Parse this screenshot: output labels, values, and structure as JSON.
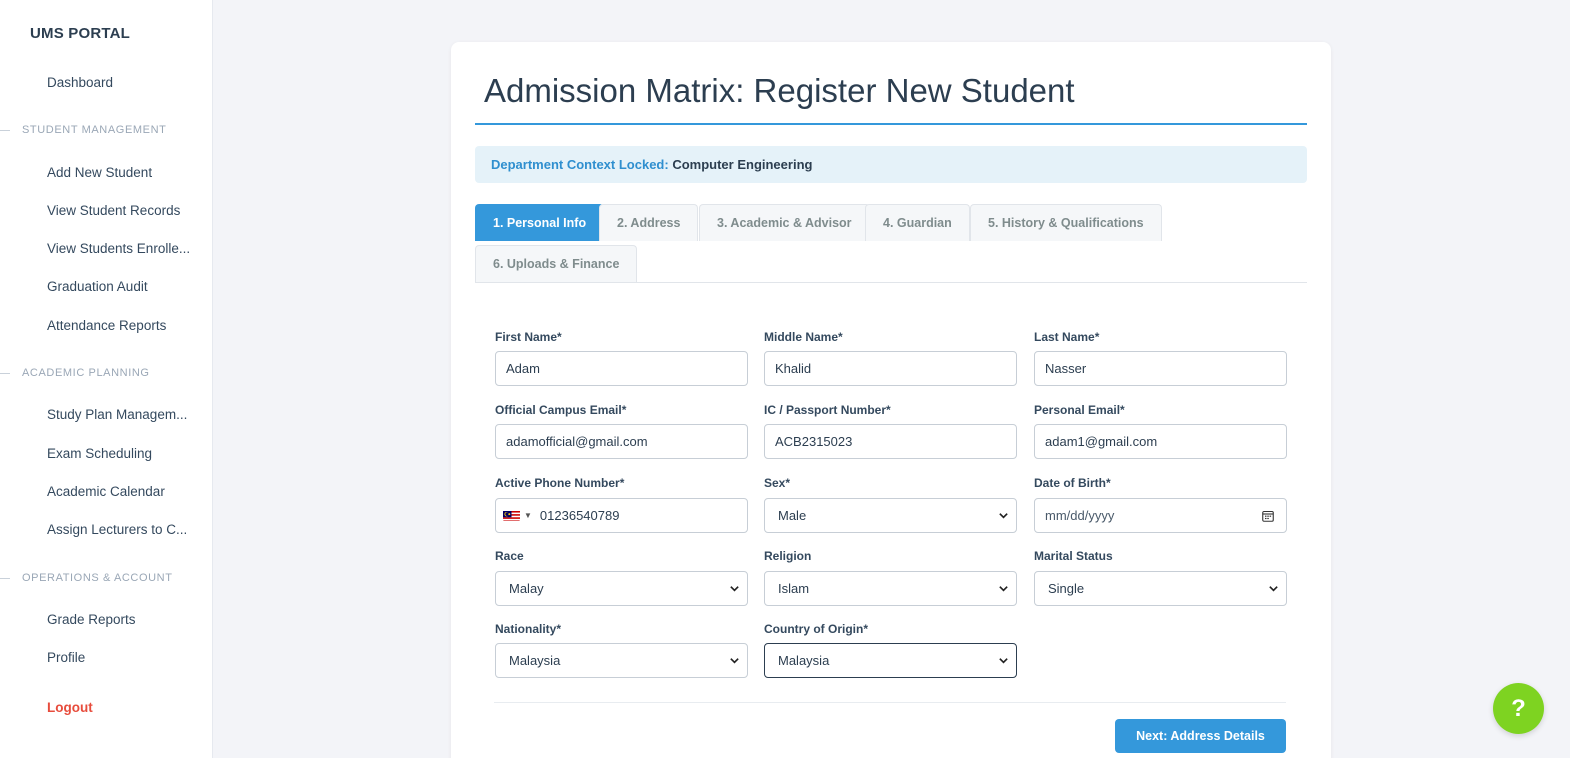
{
  "sidebar": {
    "brand": "UMS PORTAL",
    "dashboard": "Dashboard",
    "sections": [
      {
        "title": "STUDENT MANAGEMENT",
        "items": [
          "Add New Student",
          "View Student Records",
          "View Students Enrolle...",
          "Graduation Audit",
          "Attendance Reports"
        ]
      },
      {
        "title": "ACADEMIC PLANNING",
        "items": [
          "Study Plan Managem...",
          "Exam Scheduling",
          "Academic Calendar",
          "Assign Lecturers to C..."
        ]
      },
      {
        "title": "OPERATIONS & ACCOUNT",
        "items": [
          "Grade Reports",
          "Profile"
        ]
      }
    ],
    "logout": "Logout"
  },
  "page": {
    "title": "Admission Matrix: Register New Student",
    "alert_label": "Department Context Locked:",
    "alert_value": "Computer Engineering"
  },
  "tabs": [
    {
      "label": "1. Personal Info",
      "active": true
    },
    {
      "label": "2. Address",
      "active": false
    },
    {
      "label": "3. Academic & Advisor",
      "active": false
    },
    {
      "label": "4. Guardian",
      "active": false
    },
    {
      "label": "5. History & Qualifications",
      "active": false
    },
    {
      "label": "6. Uploads & Finance",
      "active": false
    }
  ],
  "form": {
    "first_name": {
      "label": "First Name*",
      "value": "Adam"
    },
    "middle_name": {
      "label": "Middle Name*",
      "value": "Khalid"
    },
    "last_name": {
      "label": "Last Name*",
      "value": "Nasser"
    },
    "campus_email": {
      "label": "Official Campus Email*",
      "value": "adamofficial@gmail.com"
    },
    "passport": {
      "label": "IC / Passport Number*",
      "value": "ACB2315023"
    },
    "personal_email": {
      "label": "Personal Email*",
      "value": "adam1@gmail.com"
    },
    "phone": {
      "label": "Active Phone Number*",
      "value": "01236540789",
      "country_flag": "malaysia-flag-icon"
    },
    "sex": {
      "label": "Sex*",
      "value": "Male"
    },
    "dob": {
      "label": "Date of Birth*",
      "placeholder": "mm/dd/yyyy"
    },
    "race": {
      "label": "Race",
      "value": "Malay"
    },
    "religion": {
      "label": "Religion",
      "value": "Islam"
    },
    "marital_status": {
      "label": "Marital Status",
      "value": "Single"
    },
    "nationality": {
      "label": "Nationality*",
      "value": "Malaysia"
    },
    "country_of_origin": {
      "label": "Country of Origin*",
      "value": "Malaysia"
    }
  },
  "actions": {
    "next_label": "Next: Address Details",
    "help_label": "?"
  },
  "colors": {
    "accent": "#3498db",
    "danger": "#e74c3c",
    "help": "#7ed321",
    "alert_bg": "#e5f2f9"
  }
}
